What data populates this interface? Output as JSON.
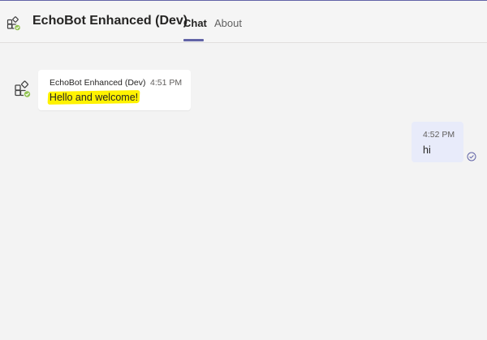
{
  "header": {
    "title": "EchoBot Enhanced (Dev)",
    "tabs": [
      {
        "label": "Chat",
        "active": true
      },
      {
        "label": "About",
        "active": false
      }
    ],
    "avatar_icon": "app-bot-icon",
    "status_icon": "available-check-icon"
  },
  "messages": [
    {
      "from": "bot",
      "sender": "EchoBot Enhanced (Dev)",
      "time": "4:51 PM",
      "text": "Hello and welcome!",
      "highlight_color": "#fff200"
    },
    {
      "from": "user",
      "time": "4:52 PM",
      "text": "hi",
      "status_icon": "read-receipt-icon"
    }
  ],
  "colors": {
    "accent": "#6264a7",
    "presence_available": "#92c353",
    "user_bubble": "#e8ebfa",
    "bot_bubble": "#ffffff",
    "background": "#f3f3f3"
  }
}
